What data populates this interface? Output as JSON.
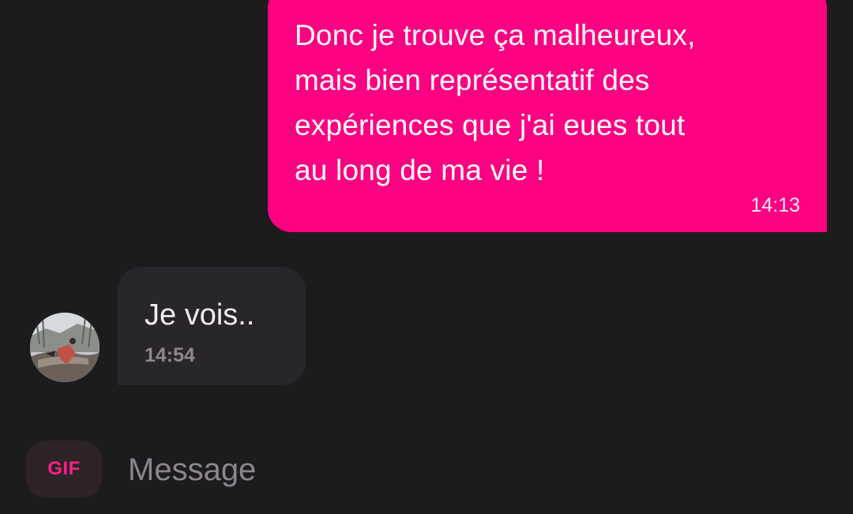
{
  "conversation": {
    "messages": [
      {
        "direction": "outgoing",
        "text": "Donc je trouve ça malheureux,\nmais bien représentatif des\nexpériences que j'ai eues tout\nau long de ma vie !",
        "time": "14:13"
      },
      {
        "direction": "incoming",
        "text": "Je vois..",
        "time": "14:54",
        "avatar": "contact-photo"
      }
    ]
  },
  "composer": {
    "gif_label": "GIF",
    "placeholder": "Message",
    "value": ""
  },
  "colors": {
    "background": "#1c1b1d",
    "outgoing_bubble": "#fc0181",
    "incoming_bubble": "#28262a",
    "accent": "#fe1e86"
  }
}
